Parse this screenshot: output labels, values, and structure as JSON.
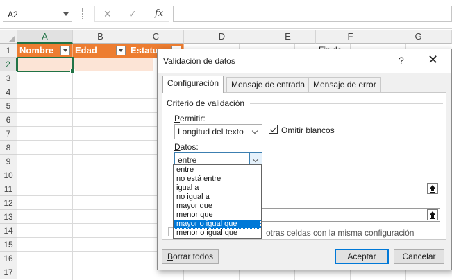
{
  "formula_bar": {
    "name_box": "A2",
    "cancel_glyph": "✕",
    "enter_glyph": "✓",
    "fx_label": "fx",
    "formula": ""
  },
  "sheet": {
    "columns": [
      "A",
      "B",
      "C",
      "D",
      "E",
      "F",
      "G"
    ],
    "rows": [
      "1",
      "2",
      "3",
      "4",
      "5",
      "6",
      "7",
      "8",
      "9",
      "10",
      "11",
      "12",
      "13",
      "14",
      "15",
      "16",
      "17"
    ],
    "selected_column": "A",
    "selected_row": "2",
    "headers": {
      "a1": "Nombre",
      "b1": "Edad",
      "c1": "Estatu",
      "e1_partial": "Fin de"
    },
    "colors": {
      "header_fill": "#ed7d31",
      "row2_fill": "#fce4d6",
      "accent": "#217346"
    }
  },
  "dialog": {
    "title": "Validación de datos",
    "help": "?",
    "close": "✕",
    "tabs": [
      "Configuración",
      "Mensaje de entrada",
      "Mensaje de error"
    ],
    "active_tab": "Configuración",
    "group_title": "Criterio de validación",
    "allow_label_u": "P",
    "allow_label_rest": "ermitir:",
    "allow_value": "Longitud del texto",
    "ignore_blank_pre": "Omitir blanco",
    "ignore_blank_u": "s",
    "ignore_blank_checked": true,
    "data_label_u": "D",
    "data_label_rest": "atos:",
    "data_value": "entre",
    "data_options": [
      "entre",
      "no está entre",
      "igual a",
      "no igual a",
      "mayor que",
      "menor que",
      "mayor o igual que",
      "menor o igual que"
    ],
    "data_options_highlighted": "mayor o igual que",
    "apply_all_tail": "otras celdas con la misma configuración",
    "apply_all_checked": false,
    "clear_all_u": "B",
    "clear_all_rest": "orrar todos",
    "ok": "Aceptar",
    "cancel": "Cancelar"
  }
}
